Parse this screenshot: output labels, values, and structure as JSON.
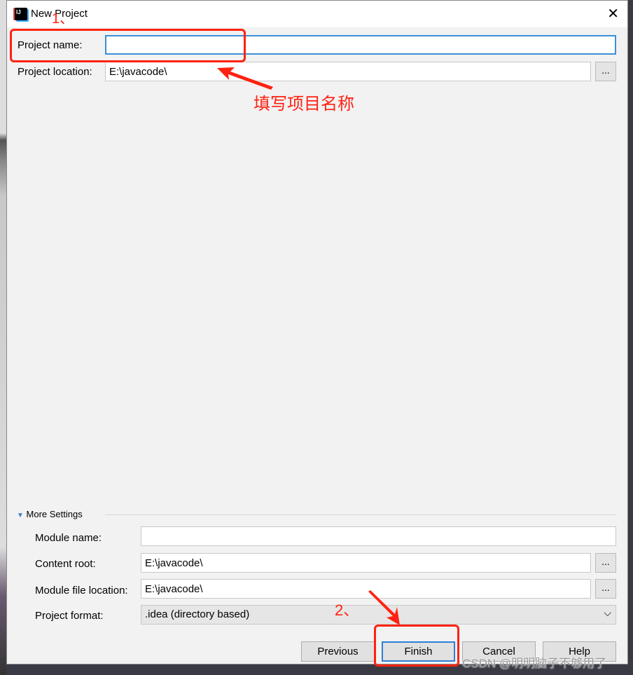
{
  "title": "New Project",
  "fields": {
    "project_name": {
      "label": "Project name:",
      "value": ""
    },
    "project_location": {
      "label": "Project location:",
      "value": "E:\\javacode\\"
    }
  },
  "more_settings": {
    "label": "More Settings",
    "module_name": {
      "label": "Module name:",
      "value": ""
    },
    "content_root": {
      "label": "Content root:",
      "value": "E:\\javacode\\"
    },
    "module_file_location": {
      "label": "Module file location:",
      "value": "E:\\javacode\\"
    },
    "project_format": {
      "label": "Project format:",
      "value": ".idea (directory based)"
    }
  },
  "browse_label": "...",
  "buttons": {
    "previous": "Previous",
    "finish": "Finish",
    "cancel": "Cancel",
    "help": "Help"
  },
  "annotations": {
    "step1": "1、",
    "step2": "2、",
    "hint": "填写项目名称"
  },
  "watermark": "CSDN @明明脑子不够用了",
  "colors": {
    "annotation": "#ff2211",
    "focus": "#3d8fd6"
  }
}
